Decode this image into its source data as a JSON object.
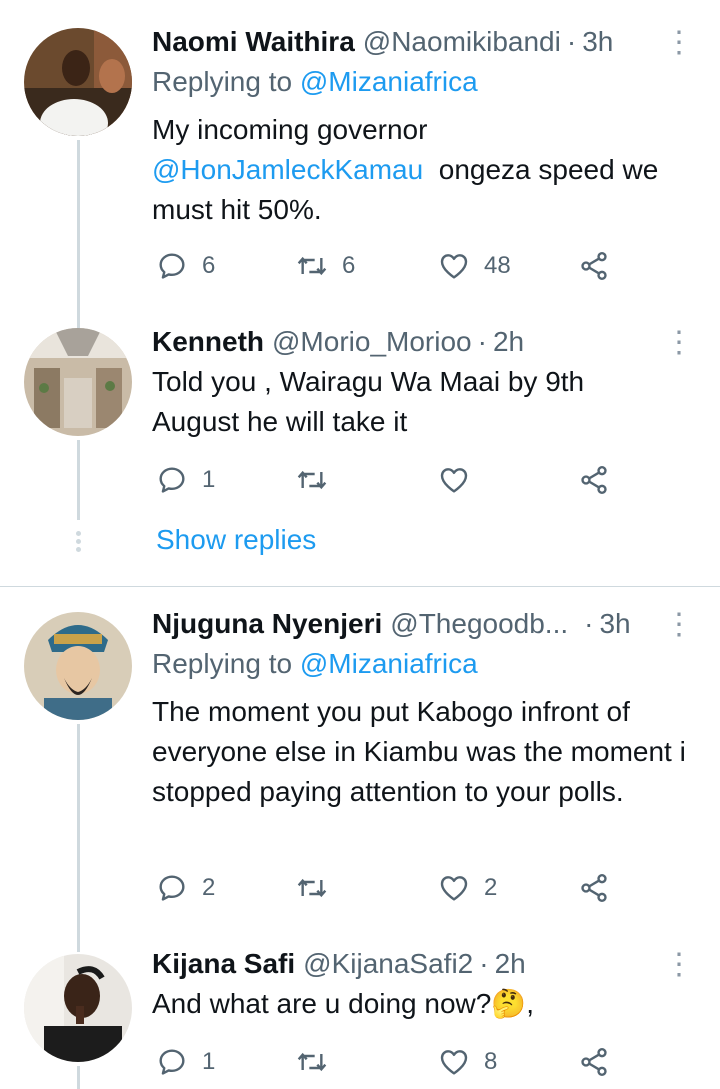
{
  "tweets": [
    {
      "name": "Naomi Waithira",
      "handle": "@Naomikibandi",
      "time": "3h",
      "replying_prefix": "Replying to",
      "replying_to": "@Mizaniafrica",
      "body_mention": "@HonJamleckKamau",
      "body_before": "My incoming governor",
      "body_after": "ongeza speed we must hit 50%.",
      "replies": "6",
      "retweets": "6",
      "likes": "48"
    },
    {
      "name": "Kenneth",
      "handle": "@Morio_Morioo",
      "time": "2h",
      "body": "Told you , Wairagu Wa Maai by 9th August he will take it",
      "replies": "1",
      "retweets": "",
      "likes": ""
    },
    {
      "name": "Njuguna Nyenjeri",
      "handle": "@Thegoodb...",
      "time": "3h",
      "replying_prefix": "Replying to",
      "replying_to": "@Mizaniafrica",
      "body": "The moment you put Kabogo infront of everyone else in Kiambu was the moment i stopped paying attention to your polls.",
      "replies": "2",
      "retweets": "",
      "likes": "2"
    },
    {
      "name": "Kijana Safi",
      "handle": "@KijanaSafi2",
      "time": "2h",
      "body": "And what are u doing now?🤔,",
      "replies": "1",
      "retweets": "",
      "likes": "8"
    }
  ],
  "show_replies": "Show replies",
  "icons": [
    "reply-icon",
    "retweet-icon",
    "like-icon",
    "share-icon",
    "more-icon"
  ],
  "colors": {
    "link": "#1d9bf0",
    "muted": "#536471",
    "line": "#cfd9de"
  }
}
